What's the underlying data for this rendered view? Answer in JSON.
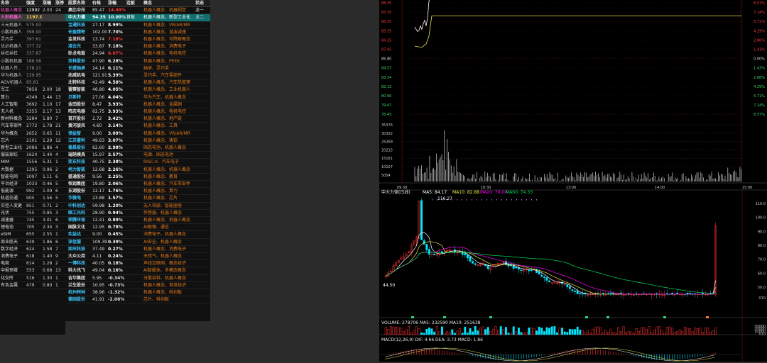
{
  "left_table": {
    "columns": [
      "名称",
      "强度",
      "涨幅",
      "涨停"
    ],
    "rows": [
      {
        "name": "机器人概念",
        "strength": "12992",
        "change": "2.03",
        "limit": "24",
        "highlight": "pink"
      },
      {
        "name": "人形机器人",
        "strength": "1197.01",
        "change": "",
        "limit": "",
        "highlight": "selected"
      },
      {
        "name": "三元机器人",
        "strength": "575.93",
        "change": "",
        "limit": "",
        "highlight": "dim"
      },
      {
        "name": "小鹏机器人",
        "strength": "399.00",
        "change": "",
        "limit": "",
        "highlight": "dim"
      },
      {
        "name": "灵巧手",
        "strength": "397.61",
        "change": "",
        "limit": "",
        "highlight": "dim"
      },
      {
        "name": "优必机器人",
        "strength": "377.32",
        "change": "",
        "limit": "",
        "highlight": "dim"
      },
      {
        "name": "丝杠丝杠",
        "strength": "337.87",
        "change": "",
        "limit": "",
        "highlight": "dim"
      },
      {
        "name": "小鹏机机器",
        "strength": "188.58",
        "change": "",
        "limit": "",
        "highlight": "dim"
      },
      {
        "name": "机器人传...",
        "strength": "178.21",
        "change": "",
        "limit": "",
        "highlight": "dim"
      },
      {
        "name": "华为机器人",
        "strength": "139.95",
        "change": "",
        "limit": "",
        "highlight": "dim"
      },
      {
        "name": "AGV机器人",
        "strength": "65.81",
        "change": "",
        "limit": "",
        "highlight": "dim"
      },
      {
        "name": "军工",
        "strength": "7856",
        "change": "2.00",
        "limit": "18",
        "highlight": ""
      },
      {
        "name": "算力",
        "strength": "4349",
        "change": "1.44",
        "limit": "13",
        "highlight": ""
      },
      {
        "name": "人工智能",
        "strength": "3692",
        "limit": "17",
        "change": "1.10",
        "highlight": ""
      },
      {
        "name": "无人机",
        "strength": "3355",
        "change": "2.17",
        "limit": "13",
        "highlight": ""
      },
      {
        "name": "新材料概念",
        "strength": "3284",
        "change": "1.80",
        "limit": "7",
        "highlight": ""
      },
      {
        "name": "汽车零部件",
        "strength": "2772",
        "change": "1.78",
        "limit": "21",
        "highlight": ""
      },
      {
        "name": "华为概念",
        "strength": "2652",
        "change": "0.65",
        "limit": "11",
        "highlight": ""
      },
      {
        "name": "芯片",
        "strength": "2101",
        "change": "1.29",
        "limit": "12",
        "highlight": ""
      },
      {
        "name": "新型工业化",
        "strength": "2086",
        "change": "1.86",
        "limit": "4",
        "highlight": ""
      },
      {
        "name": "服装家纺",
        "strength": "1624",
        "change": "1.44",
        "limit": "4",
        "highlight": ""
      },
      {
        "name": "MIM",
        "strength": "1556",
        "change": "5.31",
        "limit": "1",
        "highlight": ""
      },
      {
        "name": "大数据",
        "strength": "1395",
        "change": "0.96",
        "limit": "2",
        "highlight": ""
      },
      {
        "name": "智能电网",
        "strength": "1097",
        "change": "1.11",
        "limit": "6",
        "highlight": ""
      },
      {
        "name": "平台经济",
        "strength": "1033",
        "change": "0.46",
        "limit": "5",
        "highlight": ""
      },
      {
        "name": "低能源",
        "strength": "992",
        "change": "1.09",
        "limit": "6",
        "highlight": ""
      },
      {
        "name": "轨道交通",
        "strength": "905",
        "change": "1.56",
        "limit": "5",
        "highlight": ""
      },
      {
        "name": "实控人变更",
        "strength": "851",
        "change": "0.71",
        "limit": "2",
        "highlight": ""
      },
      {
        "name": "光伏",
        "strength": "755",
        "change": "0.85",
        "limit": "3",
        "highlight": ""
      },
      {
        "name": "减速器",
        "strength": "745",
        "change": "3.01",
        "limit": "6",
        "highlight": ""
      },
      {
        "name": "锂电池",
        "strength": "705",
        "change": "2.34",
        "limit": "3",
        "highlight": ""
      },
      {
        "name": "eSIM",
        "strength": "655",
        "change": "2.55",
        "limit": "1",
        "highlight": ""
      },
      {
        "name": "商业航天",
        "strength": "639",
        "change": "1.86",
        "limit": "6",
        "highlight": ""
      },
      {
        "name": "数字经济",
        "strength": "624",
        "change": "1.58",
        "limit": "7",
        "highlight": ""
      },
      {
        "name": "消费电子",
        "strength": "618",
        "change": "1.40",
        "limit": "9",
        "highlight": ""
      },
      {
        "name": "电商",
        "strength": "614",
        "change": "1.28",
        "limit": "2",
        "highlight": ""
      },
      {
        "name": "中报预增",
        "strength": "553",
        "change": "0.68",
        "limit": "13",
        "highlight": ""
      },
      {
        "name": "化交所",
        "strength": "516",
        "change": "1.30",
        "limit": "1",
        "highlight": ""
      },
      {
        "name": "有色金属",
        "strength": "479",
        "change": "0.80",
        "limit": "1",
        "highlight": ""
      }
    ]
  },
  "stock_table": {
    "columns": [
      "股票名称",
      "价格",
      "涨幅",
      "连板",
      "概念",
      "状态"
    ],
    "rows": [
      {
        "name": "奥比中光",
        "price": "85.47",
        "change": "14.49%",
        "board": "",
        "concept": "机器人概念、机器视觉",
        "status": "龙一",
        "nc": "w",
        "cc": "r",
        "bg": ""
      },
      {
        "name": "中大力德",
        "price": "94.35",
        "change": "10.00%",
        "board": "首板",
        "concept": "机器人概念、新型工业化",
        "status": "龙二",
        "nc": "w",
        "cc": "w",
        "bg": "sel"
      },
      {
        "name": "宝通科技",
        "price": "27.17",
        "change": "8.99%",
        "board": "",
        "concept": "机器人概念、VR/AR/MR",
        "status": "",
        "nc": "c",
        "cc": "w",
        "bg": ""
      },
      {
        "name": "长盈精密",
        "price": "102.00",
        "change": "7.70%",
        "board": "",
        "concept": "机器人概念、谐波减速",
        "status": "",
        "nc": "c",
        "cc": "w",
        "bg": ""
      },
      {
        "name": "金发科技",
        "price": "13.74",
        "change": "7.18%",
        "board": "",
        "concept": "机器人概念、可降解概念",
        "status": "",
        "nc": "w",
        "cc": "r",
        "bg": ""
      },
      {
        "name": "凌云光",
        "price": "33.87",
        "change": "7.18%",
        "board": "",
        "concept": "机器人概念、消费电子",
        "status": "",
        "nc": "c",
        "cc": "w",
        "bg": ""
      },
      {
        "name": "卧龙电驱",
        "price": "24.94",
        "change": "6.67%",
        "board": "",
        "concept": "机器人概念、电机电控",
        "status": "",
        "nc": "w",
        "cc": "r",
        "bg": ""
      },
      {
        "name": "双林股份",
        "price": "47.90",
        "change": "6.28%",
        "board": "",
        "concept": "机器人概念、PEEK",
        "status": "",
        "nc": "c",
        "cc": "w",
        "bg": ""
      },
      {
        "name": "长盛轴承",
        "price": "24.14",
        "change": "6.11%",
        "board": "",
        "concept": "轴承、灵巧手",
        "status": "",
        "nc": "c",
        "cc": "w",
        "bg": ""
      },
      {
        "name": "兆威机电",
        "price": "121.91",
        "change": "5.39%",
        "board": "",
        "concept": "灵巧手、汽车零部件",
        "status": "",
        "nc": "w",
        "cc": "w",
        "bg": ""
      },
      {
        "name": "北特科技",
        "price": "42.49",
        "change": "4.58%",
        "board": "",
        "concept": "机器人概念、汽车热管理",
        "status": "",
        "nc": "w",
        "cc": "w",
        "bg": ""
      },
      {
        "name": "雷赛智能",
        "price": "46.80",
        "change": "4.05%",
        "board": "",
        "concept": "机器人概念、工业机器人",
        "status": "",
        "nc": "w",
        "cc": "w",
        "bg": ""
      },
      {
        "name": "贝斯特",
        "price": "27.06",
        "change": "4.04%",
        "board": "",
        "concept": "华为汽车、机器人概念",
        "status": "",
        "nc": "c",
        "cc": "w",
        "bg": ""
      },
      {
        "name": "金田股份",
        "price": "8.47",
        "change": "3.93%",
        "board": "",
        "concept": "机器人概念、金属铜",
        "status": "",
        "nc": "w",
        "cc": "w",
        "bg": ""
      },
      {
        "name": "鸣志电器",
        "price": "62.75",
        "change": "3.93%",
        "board": "",
        "concept": "机器人概念、电机电控",
        "status": "",
        "nc": "w",
        "cc": "w",
        "bg": ""
      },
      {
        "name": "首开股份",
        "price": "2.72",
        "change": "3.42%",
        "board": "",
        "concept": "机器人概念、地产链",
        "status": "",
        "nc": "w",
        "cc": "w",
        "bg": ""
      },
      {
        "name": "黄河旋风",
        "price": "4.60",
        "change": "3.14%",
        "board": "",
        "concept": "机器人概念、工具",
        "status": "",
        "nc": "w",
        "cc": "w",
        "bg": ""
      },
      {
        "name": "领益智",
        "price": "9.00",
        "change": "3.09%",
        "board": "",
        "concept": "机器人概念、VR/AR/MR",
        "status": "",
        "nc": "c",
        "cc": "w",
        "bg": ""
      },
      {
        "name": "江苏雷利",
        "price": "49.63",
        "change": "3.07%",
        "board": "",
        "concept": "机器人概念、铸铝",
        "status": "",
        "nc": "c",
        "cc": "w",
        "bg": ""
      },
      {
        "name": "德昌股份",
        "price": "62.60",
        "change": "2.98%",
        "board": "",
        "concept": "固态电池、机器人概念",
        "status": "",
        "nc": "c",
        "cc": "w",
        "bg": ""
      },
      {
        "name": "瑞鹄模具",
        "price": "15.97",
        "change": "2.57%",
        "board": "",
        "concept": "电源、固态电池",
        "status": "",
        "nc": "w",
        "cc": "w",
        "bg": ""
      },
      {
        "name": "奕东科技",
        "price": "40.75",
        "change": "2.38%",
        "board": "",
        "concept": "RISC-V、汽车电子",
        "status": "",
        "nc": "c",
        "cc": "w",
        "bg": ""
      },
      {
        "name": "柯力智能",
        "price": "12.68",
        "change": "2.26%",
        "board": "",
        "concept": "机器人概念、机器人概念",
        "status": "",
        "nc": "c",
        "cc": "w",
        "bg": ""
      },
      {
        "name": "盛通股份",
        "price": "9.56",
        "change": "2.25%",
        "board": "",
        "concept": "机器人概念、教育",
        "status": "",
        "nc": "w",
        "cc": "w",
        "bg": ""
      },
      {
        "name": "恒润集团",
        "price": "19.80",
        "change": "2.06%",
        "board": "",
        "concept": "机器人概念、汽车零部件",
        "status": "",
        "nc": "w",
        "cc": "w",
        "bg": ""
      },
      {
        "name": "东湖股份",
        "price": "12.17",
        "change": "1.76%",
        "board": "",
        "concept": "机器人概念、算力",
        "status": "",
        "nc": "w",
        "cc": "w",
        "bg": ""
      },
      {
        "name": "华微电",
        "price": "23.88",
        "change": "1.57%",
        "board": "",
        "concept": "机器人概念、芯片",
        "status": "",
        "nc": "c",
        "cc": "w",
        "bg": ""
      },
      {
        "name": "中科创达",
        "price": "59.98",
        "change": "1.20%",
        "board": "",
        "concept": "无人驾驶、智能座舱",
        "status": "",
        "nc": "c",
        "cc": "w",
        "bg": ""
      },
      {
        "name": "顺工光科",
        "price": "28.90",
        "change": "0.94%",
        "board": "",
        "concept": "传感器、机器人概念",
        "status": "",
        "nc": "c",
        "cc": "w",
        "bg": ""
      },
      {
        "name": "荣腾环保",
        "price": "12.41",
        "change": "0.89%",
        "board": "",
        "concept": "机器人概念、机器人概念",
        "status": "",
        "nc": "c",
        "cc": "w",
        "bg": ""
      },
      {
        "name": "国脉文化",
        "price": "12.95",
        "change": "0.78%",
        "board": "",
        "concept": "AI眼镜、通信",
        "status": "",
        "nc": "w",
        "cc": "w",
        "bg": ""
      },
      {
        "name": "实益达",
        "price": "9.00",
        "change": "0.45%",
        "board": "",
        "concept": "消费电子、机器人概念",
        "status": "",
        "nc": "c",
        "cc": "w",
        "bg": ""
      },
      {
        "name": "深信服",
        "price": "109.39",
        "change": "0.39%",
        "board": "",
        "concept": "AI安全、机器人概念",
        "status": "",
        "nc": "c",
        "cc": "w",
        "bg": ""
      },
      {
        "name": "凯旺科技",
        "price": "37.49",
        "change": "0.27%",
        "board": "",
        "concept": "机器人概念、消费电子",
        "status": "",
        "nc": "c",
        "cc": "w",
        "bg": ""
      },
      {
        "name": "大众公用",
        "price": "4.11",
        "change": "0.24%",
        "board": "",
        "concept": "天然气、机器人概念",
        "status": "",
        "nc": "w",
        "cc": "w",
        "bg": ""
      },
      {
        "name": "一博科技",
        "price": "40.05",
        "change": "0.18%",
        "board": "",
        "concept": "声线互联网、概念经济",
        "status": "",
        "nc": "c",
        "cc": "w",
        "bg": ""
      },
      {
        "name": "科大讯飞",
        "price": "49.04",
        "change": "0.16%",
        "board": "",
        "concept": "AI智能体、多模态概念",
        "status": "",
        "nc": "w",
        "cc": "w",
        "bg": ""
      },
      {
        "name": "吉华集团",
        "price": "5.95",
        "change": "-0.34%",
        "board": "",
        "concept": "分散染料、机器人概念",
        "status": "",
        "nc": "w",
        "cc": "w",
        "bg": ""
      },
      {
        "name": "兰生股份",
        "price": "10.95",
        "change": "-0.73%",
        "board": "",
        "concept": "机器人概念、首发经济",
        "status": "",
        "nc": "w",
        "cc": "w",
        "bg": ""
      },
      {
        "name": "杭州柯林",
        "price": "38.96",
        "change": "-1.32%",
        "board": "",
        "concept": "机器人概念、科创板",
        "status": "",
        "nc": "c",
        "cc": "w",
        "bg": ""
      },
      {
        "name": "德固股份",
        "price": "41.91",
        "change": "-2.06%",
        "board": "",
        "concept": "芯片、科创板",
        "status": "",
        "nc": "c",
        "cc": "w",
        "bg": ""
      }
    ]
  },
  "intraday": {
    "left_axis": [
      "88.35",
      "87.35",
      "86.35",
      "85.35",
      "84.35",
      "87.05",
      "85.80",
      "84.57",
      "83.34",
      "82.12",
      "80.90",
      "79.67",
      "78.45"
    ],
    "right_axis": [
      "8.57%",
      "7.14%",
      "5.71%",
      "4.29%",
      "2.86%",
      "1.43%",
      "0.00%",
      "1.43%",
      "2.86%",
      "4.29%",
      "5.71%",
      "7.14%",
      "8.57%"
    ],
    "volume_axis": [
      "35376",
      "30322",
      "25269",
      "20215",
      "15161",
      "10107",
      "5054"
    ],
    "time_labels": [
      "09:30",
      "10:30",
      "13:00",
      "14:00",
      "15:00"
    ]
  },
  "kline": {
    "legend_title": "中大力德(日线)",
    "legend_ma5": "MA5: 84.17",
    "legend_ma10": "MA10: 82.88",
    "legend_ma20": "MA20: 79.00",
    "legend_ma60": "MA60: 74.33",
    "high_label": "116.27",
    "low_label": "44.50",
    "axis": [
      "110.0",
      "100.0",
      "90.0",
      "80.0",
      "70.0",
      "60.0",
      "50.0",
      "X10"
    ],
    "volume_legend": "VOLUME: 278706  MA5: 232590  MA10: 251638",
    "volume_axis": [
      "30000",
      "20000",
      "10000",
      "X10"
    ],
    "macd_legend": "MACD(12,26,9)  DIF: 4.66  DEA: 3.73  MACD: 1.86"
  },
  "colors": {
    "up": "#ff3030",
    "down": "#00e5ff",
    "price_line": "#ffffff",
    "avg_line": "#e8e84a",
    "ma5": "#ffffff",
    "ma10": "#e8e84a",
    "ma20": "#ff00ff",
    "ma60": "#00e05a"
  }
}
